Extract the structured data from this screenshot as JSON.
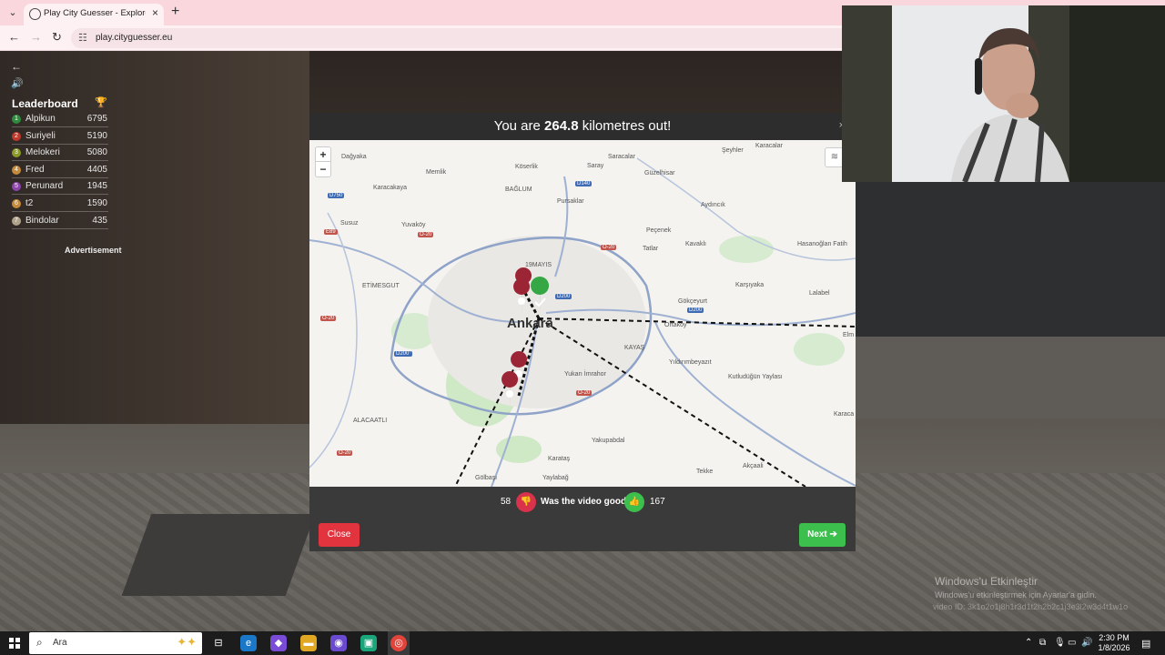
{
  "browser": {
    "tab_title": "Play City Guesser - Explore the",
    "url": "play.cityguesser.eu"
  },
  "leaderboard": {
    "title": "Leaderboard",
    "rows": [
      {
        "rank": "1",
        "name": "Alpikun",
        "score": "6795",
        "color": "#2e8b3e"
      },
      {
        "rank": "2",
        "name": "Suriyeli",
        "score": "5190",
        "color": "#c0392b"
      },
      {
        "rank": "3",
        "name": "Melokeri",
        "score": "5080",
        "color": "#8c9a2a"
      },
      {
        "rank": "4",
        "name": "Fred",
        "score": "4405",
        "color": "#c58a3a"
      },
      {
        "rank": "5",
        "name": "Perunard",
        "score": "1945",
        "color": "#8e44ad"
      },
      {
        "rank": "6",
        "name": "t2",
        "score": "1590",
        "color": "#c58a3a"
      },
      {
        "rank": "7",
        "name": "Bindolar",
        "score": "435",
        "color": "#b0a38c"
      }
    ],
    "ad_label": "Advertisement"
  },
  "modal": {
    "prefix": "You are ",
    "distance": "264.8",
    "suffix": " kilometres out!",
    "close_x": "×"
  },
  "map": {
    "zoom_in": "+",
    "zoom_out": "−",
    "city": "Ankara",
    "places": [
      "Dağyaka",
      "Memlik",
      "Köserlik",
      "Saray",
      "Saracalar",
      "Güzelhisar",
      "Şeyhler",
      "Karacalar",
      "Karacakaya",
      "BAĞLUM",
      "Pursaklar",
      "Aydıncık",
      "Susuz",
      "Yuvaköy",
      "Peçenek",
      "Kavaklı",
      "Tatlar",
      "Hasanoğlan Fatih",
      "19MAYIS",
      "ETİMESGUT",
      "Gökçeyurt",
      "Karşıyaka",
      "Lalabel",
      "Ortaköy",
      "KAYAŞ",
      "Yıldırımbeyazıt",
      "Kutludüğün Yaylası",
      "Yukarı İmrahor",
      "ALACAATLI",
      "Yakupabdal",
      "Karataş",
      "Tekke",
      "Akçaali",
      "Gölbaşı",
      "Yaylabağ",
      "Elm",
      "Karaca"
    ],
    "roads": [
      "D750",
      "D140",
      "E89",
      "O-20",
      "D200",
      "D200",
      "O-20",
      "D200",
      "O-20",
      "O-20",
      "O-20",
      "D200"
    ]
  },
  "vote": {
    "down_count": "58",
    "question": "Was the video good?",
    "up_count": "167"
  },
  "buttons": {
    "close": "Close",
    "next": "Next ➔"
  },
  "watermark": {
    "title": "Windows'u Etkinleştir",
    "subtitle": "Windows'u etkinleştirmek için Ayarlar'a gidin.",
    "video_id": "video ID: 3k1o2o1j8h1r3d1t2h2b2c1j3e3l2w3d4t1w1o"
  },
  "taskbar": {
    "search_placeholder": "Ara",
    "time": "2:30 PM",
    "date": "1/8/2026"
  }
}
